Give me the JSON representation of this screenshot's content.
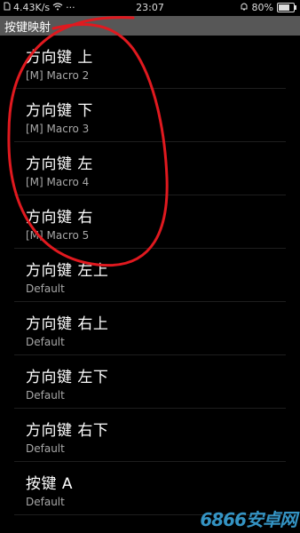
{
  "status_bar": {
    "net_speed": "4.43K/s",
    "dots": "···",
    "time": "23:07",
    "battery": "80%",
    "icons": [
      "sim-icon",
      "wifi-icon",
      "alarm-icon",
      "battery-icon"
    ]
  },
  "app_title": "按键映射",
  "items": [
    {
      "title": "方向键 上",
      "subtitle": "[M] Macro 2"
    },
    {
      "title": "方向键 下",
      "subtitle": "[M] Macro 3"
    },
    {
      "title": "方向键 左",
      "subtitle": "[M] Macro 4"
    },
    {
      "title": "方向键 右",
      "subtitle": "[M] Macro 5"
    },
    {
      "title": "方向键 左上",
      "subtitle": "Default"
    },
    {
      "title": "方向键 右上",
      "subtitle": "Default"
    },
    {
      "title": "方向键 左下",
      "subtitle": "Default"
    },
    {
      "title": "方向键 右下",
      "subtitle": "Default"
    },
    {
      "title": "按键 A",
      "subtitle": "Default"
    }
  ],
  "watermark": "6866安卓网",
  "colors": {
    "title_bar": "#575757",
    "annotation": "#e0191f",
    "watermark": "#3aa3d9"
  }
}
